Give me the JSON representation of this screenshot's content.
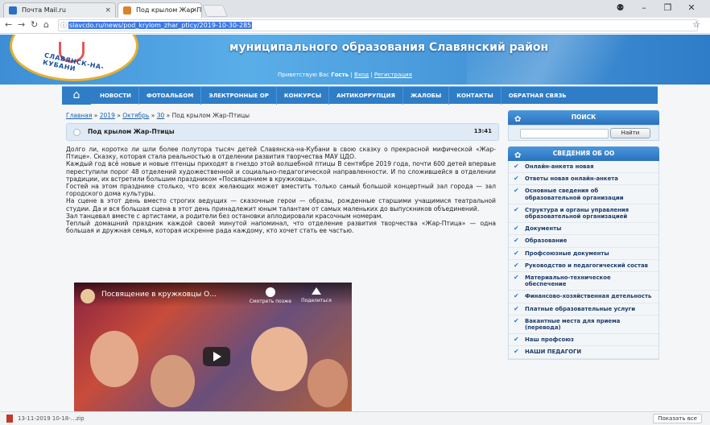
{
  "browser": {
    "tabs": [
      {
        "label": "Почта Mail.ru"
      },
      {
        "label": "Под крылом Жар-Птиц"
      }
    ],
    "url": "slavcdo.ru/news/pod_krylom_zhar_pticy/2019-10-30-285"
  },
  "header": {
    "title": "муниципального образования Славянский район",
    "logo_text": "СЛАВЯНСК-НА-КУБАНИ",
    "greeting_prefix": "Приветствую Вас",
    "greeting_user": "Гость",
    "login": "Вход",
    "register": "Регистрация"
  },
  "menu": [
    "НОВОСТИ",
    "ФОТОАЛЬБОМ",
    "ЭЛЕКТРОННЫЕ ОР",
    "КОНКУРСЫ",
    "АНТИКОРРУПЦИЯ",
    "ЖАЛОБЫ",
    "КОНТАКТЫ",
    "ОБРАТНАЯ СВЯЗЬ"
  ],
  "breadcrumb": {
    "home": "Главная",
    "year": "2019",
    "month": "Октябрь",
    "day": "30",
    "current": "Под крылом Жар-Птицы"
  },
  "post": {
    "title": "Под крылом Жар-Птицы",
    "time": "13:41",
    "paragraphs": [
      "Долго ли, коротко ли шли более полутора тысяч детей Славянска-на-Кубани в свою сказку о прекрасной мифической «Жар-Птице». Сказку, которая стала реальностью в отделении развития творчества МАУ ЦДО.",
      "Каждый год всё новые и новые птенцы приходят в гнездо этой волшебной птицы В сентябре 2019 года, почти 600 детей впервые переступили порог 48 отделений художественной и социально-педагогической направленности. И по сложившейся в отделении традиции, их встретили большим праздником «Посвящением в кружковцы».",
      "Гостей на этом празднике столько, что всех желающих может вместить только самый большой концертный зал города — зал городского дома культуры.",
      "На сцене в этот день вместо строгих ведущих — сказочные герои — образы, рожденные старшими учащимися театральной студии. Да и вся большая сцена в этот день принадлежит юным талантам от самых маленьких до выпускников объединений.",
      "Зал танцевал вместе с артистами, а родители без остановки аплодировали красочным номерам.",
      "Теплый домашний праздник каждой своей минутой напоминал, что отделение развития творчества «Жар-Птица» — одна большая и дружная семья, которая искренне рада каждому, кто хочет стать ее частью."
    ]
  },
  "video": {
    "title": "Посвящение в кружковцы О...",
    "watch_later": "Смотреть позже",
    "share": "Поделиться"
  },
  "sidebar": {
    "search_title": "ПОИСК",
    "search_button": "Найти",
    "info_title": "СВЕДЕНИЯ ОБ ОО",
    "links": [
      "Онлайн-анкета новая",
      "Ответы новая онлайн-анкета",
      "Основные сведения об образовательной организации",
      "Структура и органы управления образовательной организацией",
      "Документы",
      "Образование",
      "Профсоюзные документы",
      "Руководство и педагогический состав",
      "Материально-техническое обеспечение",
      "Финансово-хозяйственная детельность",
      "Платные образовательные услуги",
      "Вакантные места для приема (перевода)",
      "Наш профсоюз",
      "НАШИ ПЕДАГОГИ"
    ]
  },
  "downloads": {
    "file": "13-11-2019 10-18-...zip",
    "show_all": "Показать все"
  }
}
